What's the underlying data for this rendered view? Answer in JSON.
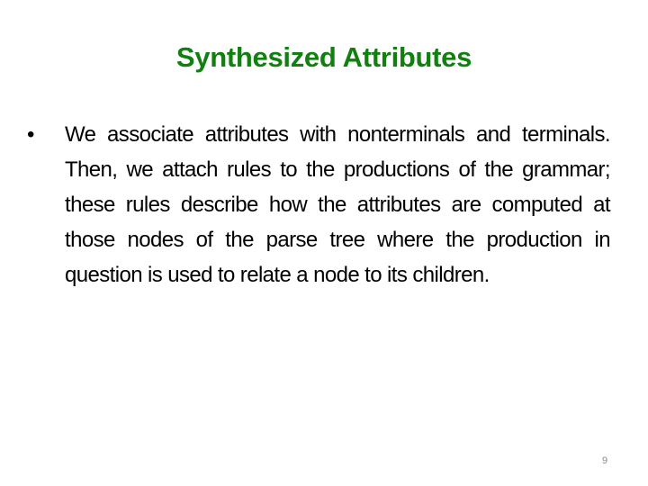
{
  "slide": {
    "title": "Synthesized Attributes",
    "title_color": "#118011",
    "bullets": [
      {
        "marker": "•",
        "text": "We associate attributes with nonterminals and terminals. Then, we attach rules to the productions of the grammar; these rules describe how the attributes are computed at those nodes of the parse tree where the production in question is used to relate a node to its children."
      }
    ],
    "page_number": "9"
  }
}
